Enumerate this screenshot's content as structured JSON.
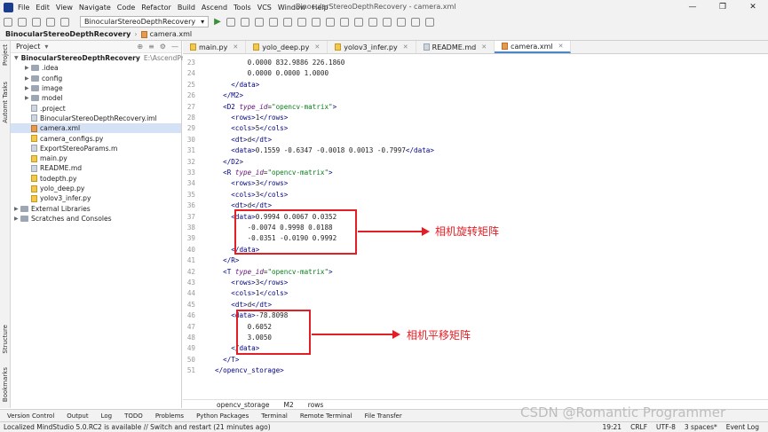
{
  "menu": {
    "items": [
      "File",
      "Edit",
      "View",
      "Navigate",
      "Code",
      "Refactor",
      "Build",
      "Ascend",
      "Tools",
      "VCS",
      "Window",
      "Help"
    ],
    "window_title": "BinocularStereoDepthRecovery - camera.xml",
    "minimize": "—",
    "maximize": "❐",
    "close": "✕"
  },
  "toolbar": {
    "run_config": "BinocularStereoDepthRecovery"
  },
  "nav": {
    "project": "BinocularStereoDepthRecovery",
    "file": "camera.xml"
  },
  "side": {
    "project_label": "Project",
    "tasks_label": "Automt Tasks",
    "structure_label": "Structure",
    "bookmarks_label": "Bookmarks"
  },
  "project": {
    "header": "Project",
    "root": {
      "name": "BinocularStereoDepthRecovery",
      "path": "E:\\AscendProjects"
    },
    "items": [
      {
        "name": ".idea",
        "kind": "folder"
      },
      {
        "name": "config",
        "kind": "folder"
      },
      {
        "name": "image",
        "kind": "folder"
      },
      {
        "name": "model",
        "kind": "folder"
      },
      {
        "name": ".project",
        "kind": "file"
      },
      {
        "name": "BinocularStereoDepthRecovery.iml",
        "kind": "file"
      },
      {
        "name": "camera.xml",
        "kind": "xml"
      },
      {
        "name": "camera_configs.py",
        "kind": "py"
      },
      {
        "name": "ExportStereoParams.m",
        "kind": "file"
      },
      {
        "name": "main.py",
        "kind": "py"
      },
      {
        "name": "README.md",
        "kind": "file"
      },
      {
        "name": "todepth.py",
        "kind": "py"
      },
      {
        "name": "yolo_deep.py",
        "kind": "py"
      },
      {
        "name": "yolov3_infer.py",
        "kind": "py"
      }
    ],
    "external": "External Libraries",
    "scratches": "Scratches and Consoles"
  },
  "tabs": [
    "main.py",
    "yolo_deep.py",
    "yolov3_infer.py",
    "README.md",
    "camera.xml"
  ],
  "code": [
    {
      "n": "23",
      "t": "        0.0000 832.9886 226.1860"
    },
    {
      "n": "24",
      "t": "        0.0000 0.0000 1.0000"
    },
    {
      "n": "25",
      "t": "    </data>"
    },
    {
      "n": "26",
      "t": "  </M2>"
    },
    {
      "n": "27",
      "t": "  <D2 type_id=\"opencv-matrix\">"
    },
    {
      "n": "28",
      "t": "    <rows>1</rows>"
    },
    {
      "n": "29",
      "t": "    <cols>5</cols>"
    },
    {
      "n": "30",
      "t": "    <dt>d</dt>"
    },
    {
      "n": "31",
      "t": "    <data>0.1559 -0.6347 -0.0018 0.0013 -0.7997</data>"
    },
    {
      "n": "32",
      "t": "  </D2>"
    },
    {
      "n": "33",
      "t": "  <R type_id=\"opencv-matrix\">"
    },
    {
      "n": "34",
      "t": "    <rows>3</rows>"
    },
    {
      "n": "35",
      "t": "    <cols>3</cols>"
    },
    {
      "n": "36",
      "t": "    <dt>d</dt>"
    },
    {
      "n": "37",
      "t": "    <data>0.9994 0.0067 0.0352"
    },
    {
      "n": "38",
      "t": "        -0.0074 0.9998 0.0188"
    },
    {
      "n": "39",
      "t": "        -0.0351 -0.0190 0.9992"
    },
    {
      "n": "40",
      "t": "    </data>"
    },
    {
      "n": "41",
      "t": "  </R>"
    },
    {
      "n": "42",
      "t": "  <T type_id=\"opencv-matrix\">"
    },
    {
      "n": "43",
      "t": "    <rows>3</rows>"
    },
    {
      "n": "44",
      "t": "    <cols>1</cols>"
    },
    {
      "n": "45",
      "t": "    <dt>d</dt>"
    },
    {
      "n": "46",
      "t": "    <data>-78.8098"
    },
    {
      "n": "47",
      "t": "        0.6052"
    },
    {
      "n": "48",
      "t": "        3.0050"
    },
    {
      "n": "49",
      "t": "    </data>"
    },
    {
      "n": "50",
      "t": "  </T>"
    },
    {
      "n": "51",
      "t": "</opencv_storage>"
    }
  ],
  "annotations": {
    "rotation": "相机旋转矩阵",
    "translation": "相机平移矩阵",
    "color": "#e31e24"
  },
  "breadcrumb": [
    "opencv_storage",
    "M2",
    "rows"
  ],
  "toolwindows": [
    "Version Control",
    "Output",
    "Log",
    "TODO",
    "Problems",
    "Python Packages",
    "Terminal",
    "Remote Terminal",
    "File Transfer"
  ],
  "status": {
    "message": "Localized MindStudio 5.0.RC2 is available // Switch and restart (21 minutes ago)",
    "position": "19:21",
    "line_sep": "CRLF",
    "encoding": "UTF-8",
    "indent": "3 spaces*",
    "event_log": "Event Log"
  },
  "watermark": "CSDN @Romantic Programmer"
}
